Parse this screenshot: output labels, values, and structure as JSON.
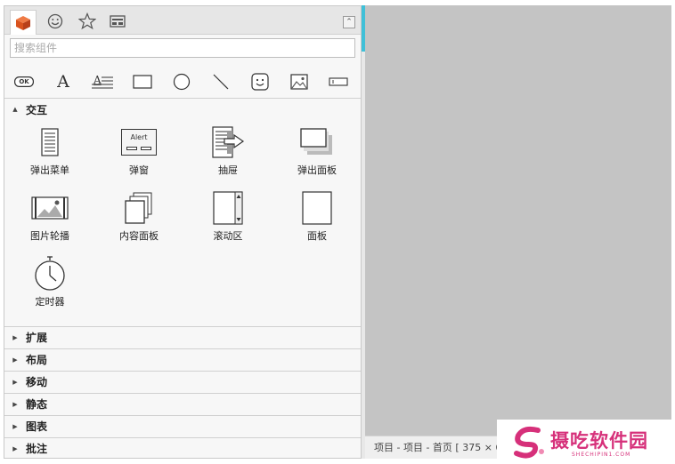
{
  "search": {
    "placeholder": "搜索组件"
  },
  "tabs": [
    {
      "name": "cube-icon",
      "active": true
    },
    {
      "name": "smiley-icon",
      "active": false
    },
    {
      "name": "star-icon",
      "active": false
    },
    {
      "name": "layout-icon",
      "active": false
    }
  ],
  "toolbar": {
    "ok_label": "OK",
    "text_glyph": "A",
    "para_glyph": "A"
  },
  "sections": {
    "interaction": {
      "title": "交互"
    },
    "collapsed": [
      "扩展",
      "布局",
      "移动",
      "静态",
      "图表",
      "批注"
    ]
  },
  "widgets": [
    {
      "label": "弹出菜单"
    },
    {
      "label": "弹窗",
      "icon_text": "Alert"
    },
    {
      "label": "抽屉"
    },
    {
      "label": "弹出面板"
    },
    {
      "label": "图片轮播"
    },
    {
      "label": "内容面板"
    },
    {
      "label": "滚动区"
    },
    {
      "label": "面板"
    },
    {
      "label": "定时器"
    }
  ],
  "statusbar": {
    "text": "项目 - 项目 - 首页 [ 375 × 6"
  },
  "watermark": {
    "text": "摄吃软件园",
    "sub": "SHECHIPIN1.COM"
  },
  "colors": {
    "accent": "#3fc0d8",
    "tab_icon": "#d9531e",
    "canvas": "#c4c4c4",
    "watermark": "#d6307a"
  }
}
